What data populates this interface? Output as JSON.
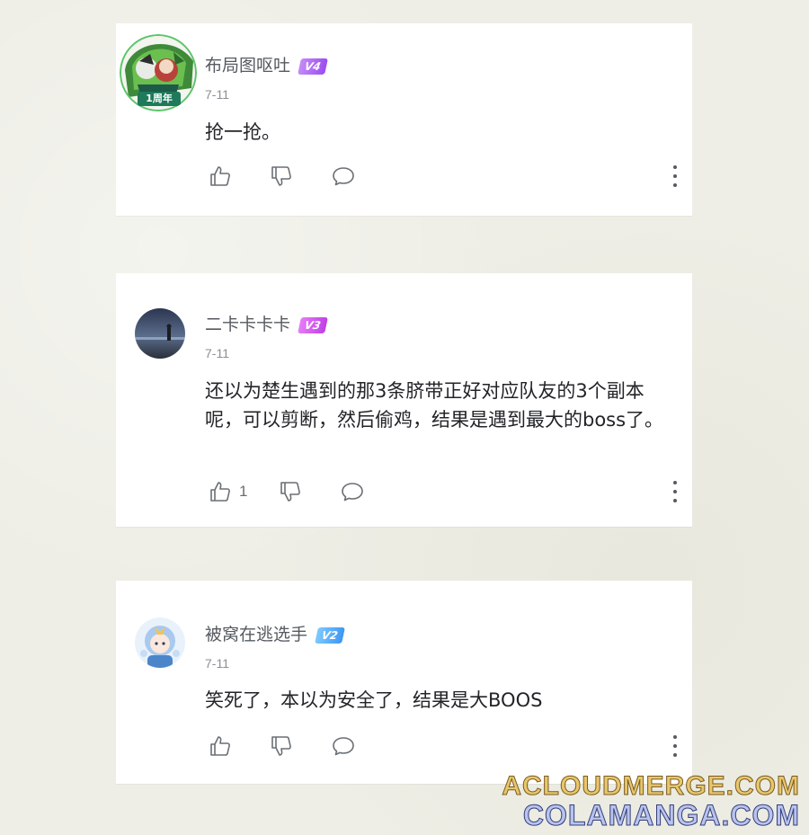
{
  "comments": [
    {
      "username": "布局图呕吐",
      "level": "V4",
      "date": "7-11",
      "text": "抢一抢。",
      "likes": "",
      "badge_text": "1周年",
      "level_color": "#a05cf2"
    },
    {
      "username": "二卡卡卡卡",
      "level": "V3",
      "date": "7-11",
      "text": "还以为楚生遇到的那3条脐带正好对应队友的3个副本呢，可以剪断，然后偷鸡，结果是遇到最大的boss了。",
      "likes": "1",
      "level_color": "#c84ee8"
    },
    {
      "username": "被窝在逃选手",
      "level": "V2",
      "date": "7-11",
      "text": "笑死了，本以为安全了，结果是大BOOS",
      "likes": "",
      "level_color": "#3d97f3"
    }
  ],
  "watermark": {
    "line1": "ACLOUDMERGE.COM",
    "line2": "COLAMANGA.COM"
  },
  "icons": [
    "thumbs-up-icon",
    "thumbs-down-icon",
    "reply-bubble-icon",
    "more-options-icon"
  ]
}
